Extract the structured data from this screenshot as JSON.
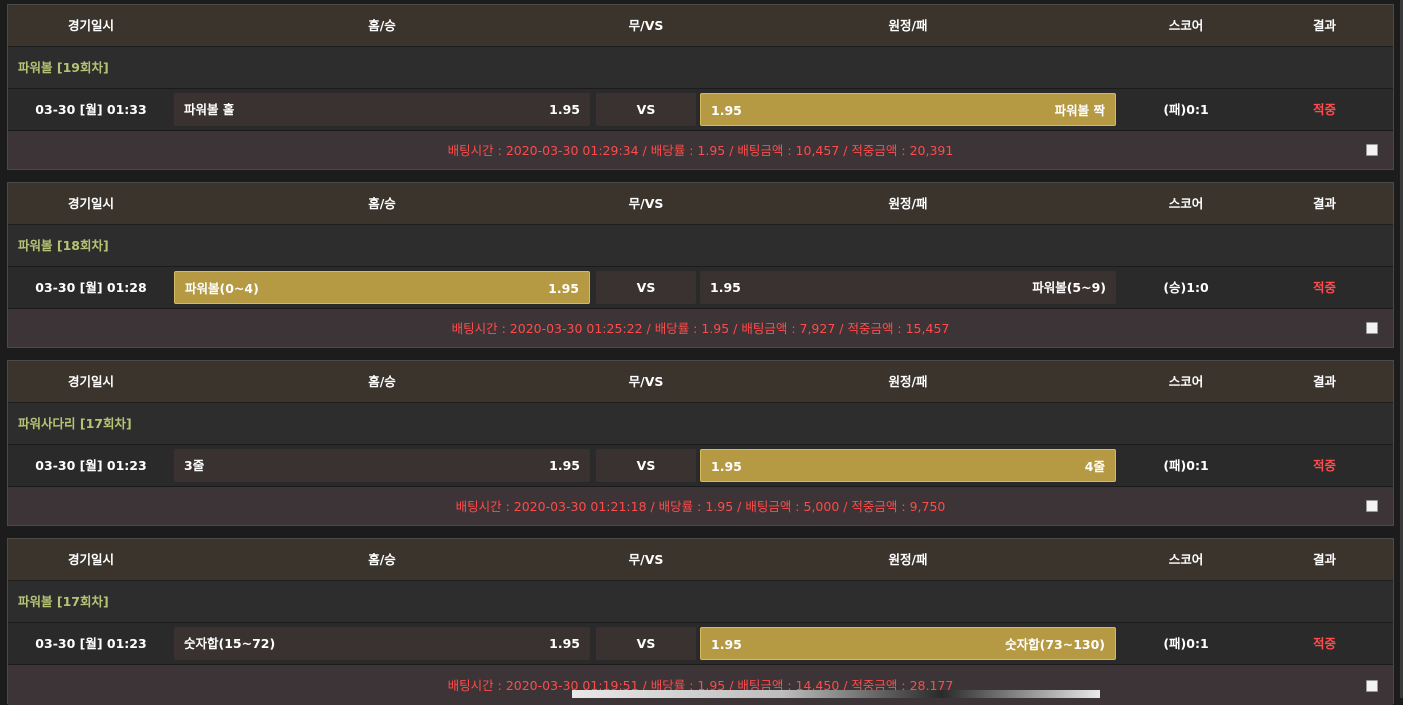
{
  "headers": {
    "time": "경기일시",
    "home": "홈/승",
    "draw": "무/VS",
    "away": "원정/패",
    "score": "스코어",
    "result": "결과"
  },
  "bets": [
    {
      "league": "파워볼  [19회차]",
      "time": "03-30 [월] 01:33",
      "home_name": "파워볼 홀",
      "home_odds": "1.95",
      "vs": "VS",
      "away_odds": "1.95",
      "away_name": "파워볼 짝",
      "selected": "away",
      "score": "(패)0:1",
      "result": "적중",
      "info": "배팅시간 : 2020-03-30 01:29:34   /   배당률 : 1.95   /   배팅금액 : 10,457   /   적중금액 : 20,391"
    },
    {
      "league": "파워볼  [18회차]",
      "time": "03-30 [월] 01:28",
      "home_name": "파워볼(0~4)",
      "home_odds": "1.95",
      "vs": "VS",
      "away_odds": "1.95",
      "away_name": "파워볼(5~9)",
      "selected": "home",
      "score": "(승)1:0",
      "result": "적중",
      "info": "배팅시간 : 2020-03-30 01:25:22   /   배당률 : 1.95   /   배팅금액 : 7,927   /   적중금액 : 15,457"
    },
    {
      "league": "파워사다리  [17회차]",
      "time": "03-30 [월] 01:23",
      "home_name": "3줄",
      "home_odds": "1.95",
      "vs": "VS",
      "away_odds": "1.95",
      "away_name": "4줄",
      "selected": "away",
      "score": "(패)0:1",
      "result": "적중",
      "info": "배팅시간 : 2020-03-30 01:21:18   /   배당률 : 1.95   /   배팅금액 : 5,000   /   적중금액 : 9,750"
    },
    {
      "league": "파워볼  [17회차]",
      "time": "03-30 [월] 01:23",
      "home_name": "숫자합(15~72)",
      "home_odds": "1.95",
      "vs": "VS",
      "away_odds": "1.95",
      "away_name": "숫자합(73~130)",
      "selected": "away",
      "score": "(패)0:1",
      "result": "적중",
      "info": "배팅시간 : 2020-03-30 01:19:51   /   배당률 : 1.95   /   배팅금액 : 14,450   /   적중금액 : 28,177"
    }
  ],
  "colors": {
    "header_bg": "#3a342d",
    "selected_bg": "#b59a43",
    "result_red": "#ff4b4b",
    "league_green": "#b7c374"
  }
}
